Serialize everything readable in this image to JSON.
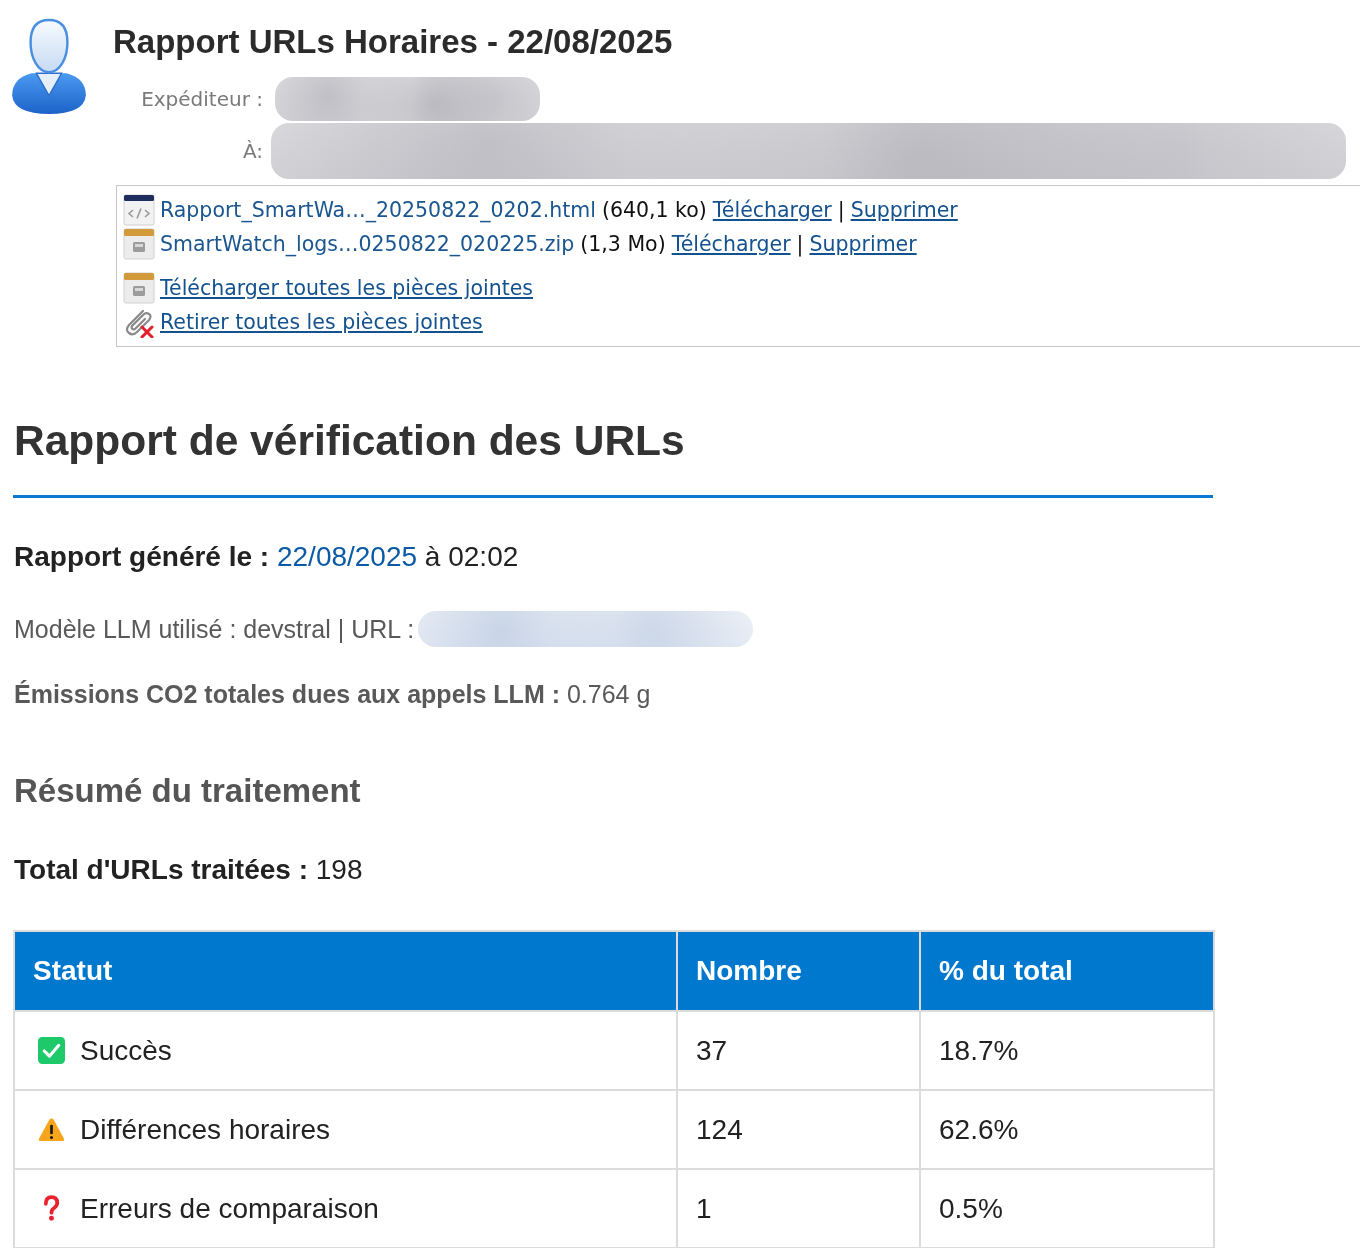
{
  "message": {
    "subject": "Rapport URLs Horaires - 22/08/2025",
    "fields": [
      {
        "label": "Expéditeur :",
        "redacted": true
      },
      {
        "label": "À:",
        "redacted": true
      }
    ]
  },
  "attachments": {
    "files": [
      {
        "kind": "html",
        "name": "Rapport_SmartWa…_20250822_0202.html",
        "size": "(640,1 ko)",
        "download": "Télécharger",
        "separator": "|",
        "delete": "Supprimer"
      },
      {
        "kind": "zip",
        "name": "SmartWatch_logs…0250822_020225.zip",
        "size": "(1,3 Mo)",
        "download": "Télécharger",
        "separator": "|",
        "delete": "Supprimer"
      }
    ],
    "actions": [
      {
        "kind": "download_all",
        "label": "Télécharger toutes les pièces jointes"
      },
      {
        "kind": "remove_all",
        "label": "Retirer toutes les pièces jointes"
      }
    ]
  },
  "report": {
    "title": "Rapport de vérification des URLs",
    "generated": {
      "label": "Rapport généré le :",
      "date": "22/08/2025",
      "time": "à 02:02"
    },
    "model_line": "Modèle LLM utilisé : devstral | URL :",
    "url_redacted": true,
    "emissions": {
      "label": "Émissions CO2 totales dues aux appels LLM :",
      "value": "0.764 g"
    },
    "summary_title": "Résumé du traitement",
    "total": {
      "label": "Total d'URLs traitées :",
      "value": "198"
    },
    "table": {
      "columns": [
        "Statut",
        "Nombre",
        "% du total"
      ],
      "rows": [
        {
          "kind": "success",
          "status": "Succès",
          "count": "37",
          "percent": "18.7%"
        },
        {
          "kind": "warning",
          "status": "Différences horaires",
          "count": "124",
          "percent": "62.6%"
        },
        {
          "kind": "error",
          "status": "Erreurs de comparaison",
          "count": "1",
          "percent": "0.5%"
        }
      ]
    }
  }
}
